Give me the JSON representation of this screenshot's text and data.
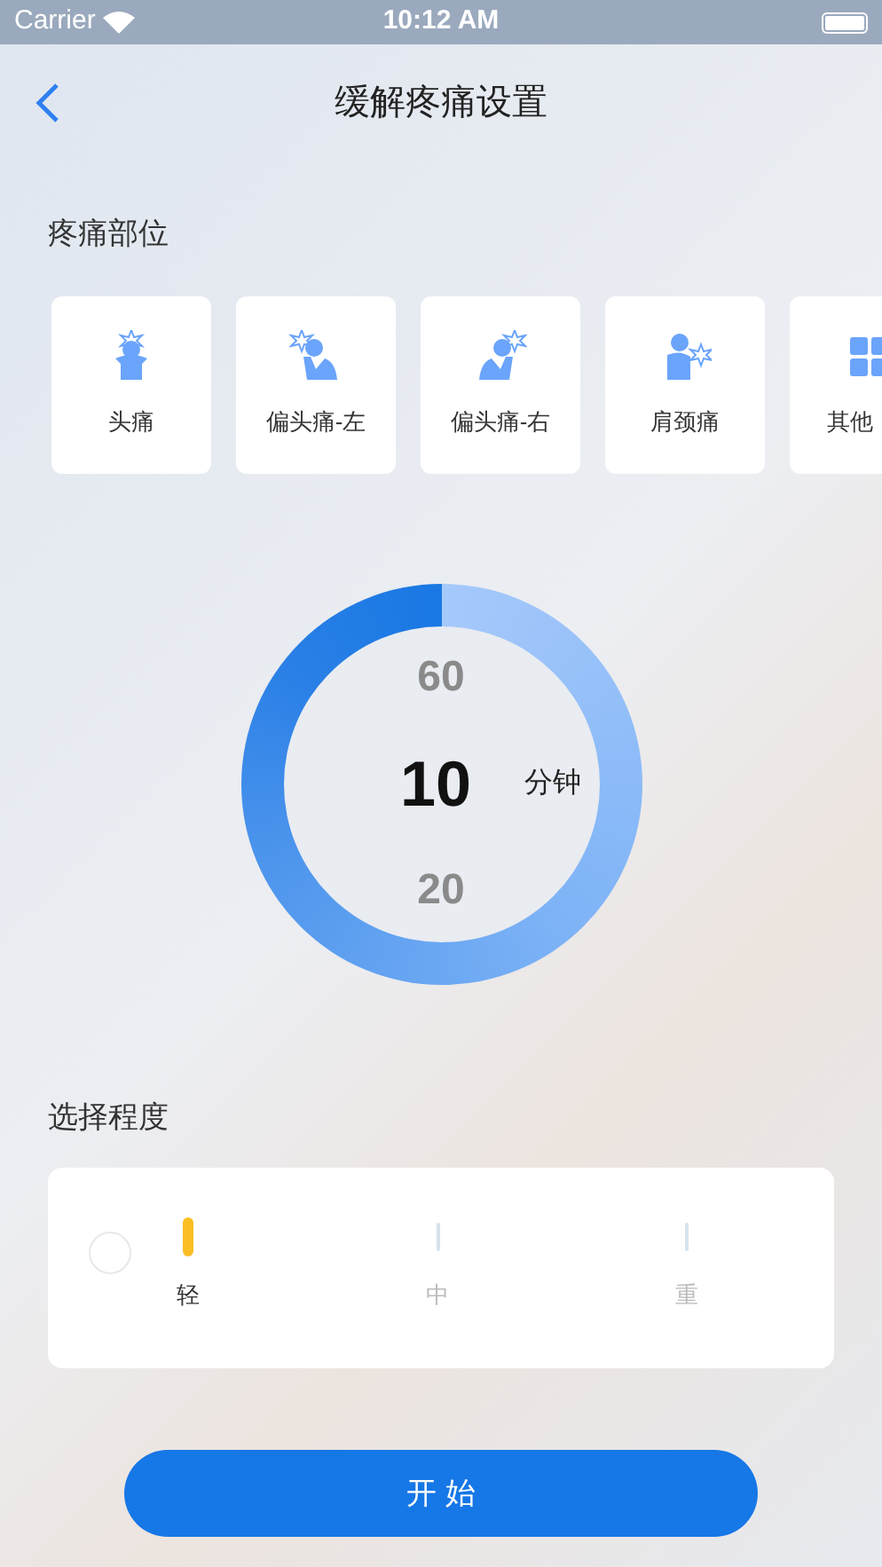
{
  "status_bar": {
    "carrier": "Carrier",
    "time": "10:12 AM"
  },
  "nav": {
    "title": "缓解疼痛设置"
  },
  "pain_area": {
    "title": "疼痛部位",
    "items": [
      {
        "label": "头痛",
        "kind": "head"
      },
      {
        "label": "偏头痛-左",
        "kind": "left"
      },
      {
        "label": "偏头痛-右",
        "kind": "right"
      },
      {
        "label": "肩颈痛",
        "kind": "shoulder"
      },
      {
        "label": "其他",
        "kind": "other"
      }
    ]
  },
  "timer": {
    "values": [
      "60",
      "10",
      "20"
    ],
    "unit": "分钟"
  },
  "intensity": {
    "title": "选择程度",
    "levels": [
      {
        "label": "轻",
        "selected": true
      },
      {
        "label": "中",
        "selected": false
      },
      {
        "label": "重",
        "selected": false
      }
    ]
  },
  "start_button": {
    "label": "开 始"
  }
}
